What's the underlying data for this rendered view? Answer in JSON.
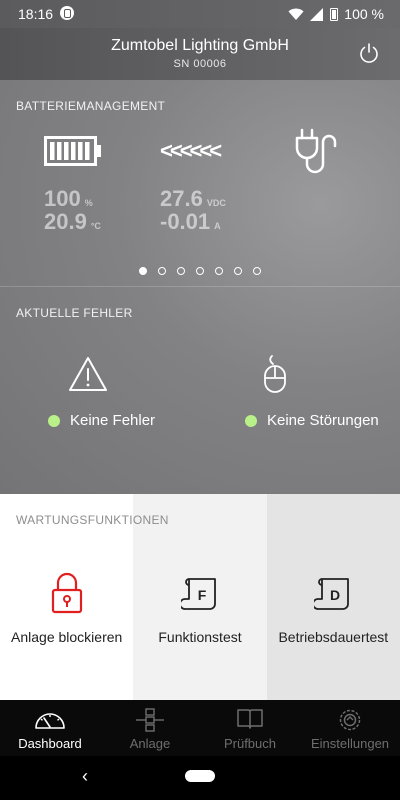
{
  "status_bar": {
    "time": "18:16",
    "battery": "100 %"
  },
  "header": {
    "title": "Zumtobel Lighting GmbH",
    "serial": "SN 00006"
  },
  "battery_management": {
    "label": "BATTERIEMANAGEMENT",
    "charge": {
      "value": "100",
      "unit": "%"
    },
    "temperature": {
      "value": "20.9",
      "unit": "°C"
    },
    "voltage": {
      "value": "27.6",
      "unit": "VDC"
    },
    "current": {
      "value": "-0.01",
      "unit": "A"
    },
    "flow_arrows": "<<<<<<",
    "page_count": 7,
    "active_page": 1
  },
  "current_errors": {
    "label": "AKTUELLE FEHLER",
    "errors_status": "Keine Fehler",
    "faults_status": "Keine Störungen",
    "status_color": "#b9f08a"
  },
  "maintenance": {
    "label": "WARTUNGSFUNKTIONEN",
    "tiles": [
      {
        "label": "Anlage blockieren",
        "icon": "lock-icon",
        "letter": ""
      },
      {
        "label": "Funktionstest",
        "icon": "scroll-f-icon",
        "letter": "F"
      },
      {
        "label": "Betriebsdauertest",
        "icon": "scroll-d-icon",
        "letter": "D"
      }
    ],
    "accent": "#e02020"
  },
  "bottom_nav": [
    {
      "label": "Dashboard",
      "icon": "gauge-icon",
      "active": true
    },
    {
      "label": "Anlage",
      "icon": "network-icon",
      "active": false
    },
    {
      "label": "Prüfbuch",
      "icon": "book-icon",
      "active": false
    },
    {
      "label": "Einstellungen",
      "icon": "settings-icon",
      "active": false
    }
  ],
  "system_nav": {
    "back": "‹"
  }
}
